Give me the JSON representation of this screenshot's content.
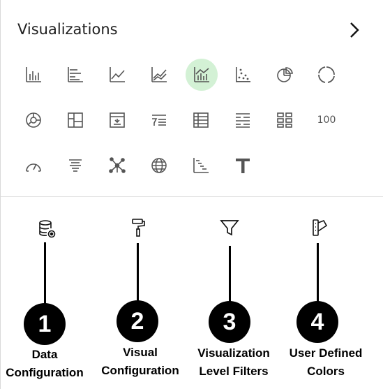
{
  "panel": {
    "title": "Visualizations",
    "expand_icon": "chevron-right-icon",
    "viz_icons": [
      {
        "name": "bar-chart-icon"
      },
      {
        "name": "horizontal-bar-chart-icon"
      },
      {
        "name": "line-chart-icon"
      },
      {
        "name": "area-chart-icon"
      },
      {
        "name": "combo-chart-icon",
        "active": true
      },
      {
        "name": "scatter-chart-icon"
      },
      {
        "name": "pie-chart-icon"
      },
      {
        "name": "donut-chart-icon"
      },
      {
        "name": "sunburst-chart-icon"
      },
      {
        "name": "tile-icon"
      },
      {
        "name": "list-icon"
      },
      {
        "name": "filter-list-icon"
      },
      {
        "name": "table-icon"
      },
      {
        "name": "pivot-table-icon"
      },
      {
        "name": "grid-icon"
      },
      {
        "name": "kpi-icon",
        "text": "100"
      },
      {
        "name": "gauge-icon"
      },
      {
        "name": "funnel-text-icon"
      },
      {
        "name": "network-icon"
      },
      {
        "name": "map-icon"
      },
      {
        "name": "waterfall-icon"
      },
      {
        "name": "text-icon"
      }
    ]
  },
  "tools": [
    {
      "icon": "database-settings-icon",
      "number": "1",
      "label_line1": "Data",
      "label_line2": "Configuration"
    },
    {
      "icon": "paint-roller-icon",
      "number": "2",
      "label_line1": "Visual",
      "label_line2": "Configuration"
    },
    {
      "icon": "funnel-icon",
      "number": "3",
      "label_line1": "Visualization",
      "label_line2": "Level Filters"
    },
    {
      "icon": "color-palette-icon",
      "number": "4",
      "label_line1": "User Defined",
      "label_line2": "Colors"
    }
  ],
  "colors": {
    "active_bg": "#d3f1d5",
    "icon": "#555555",
    "annotation": "#000000"
  }
}
